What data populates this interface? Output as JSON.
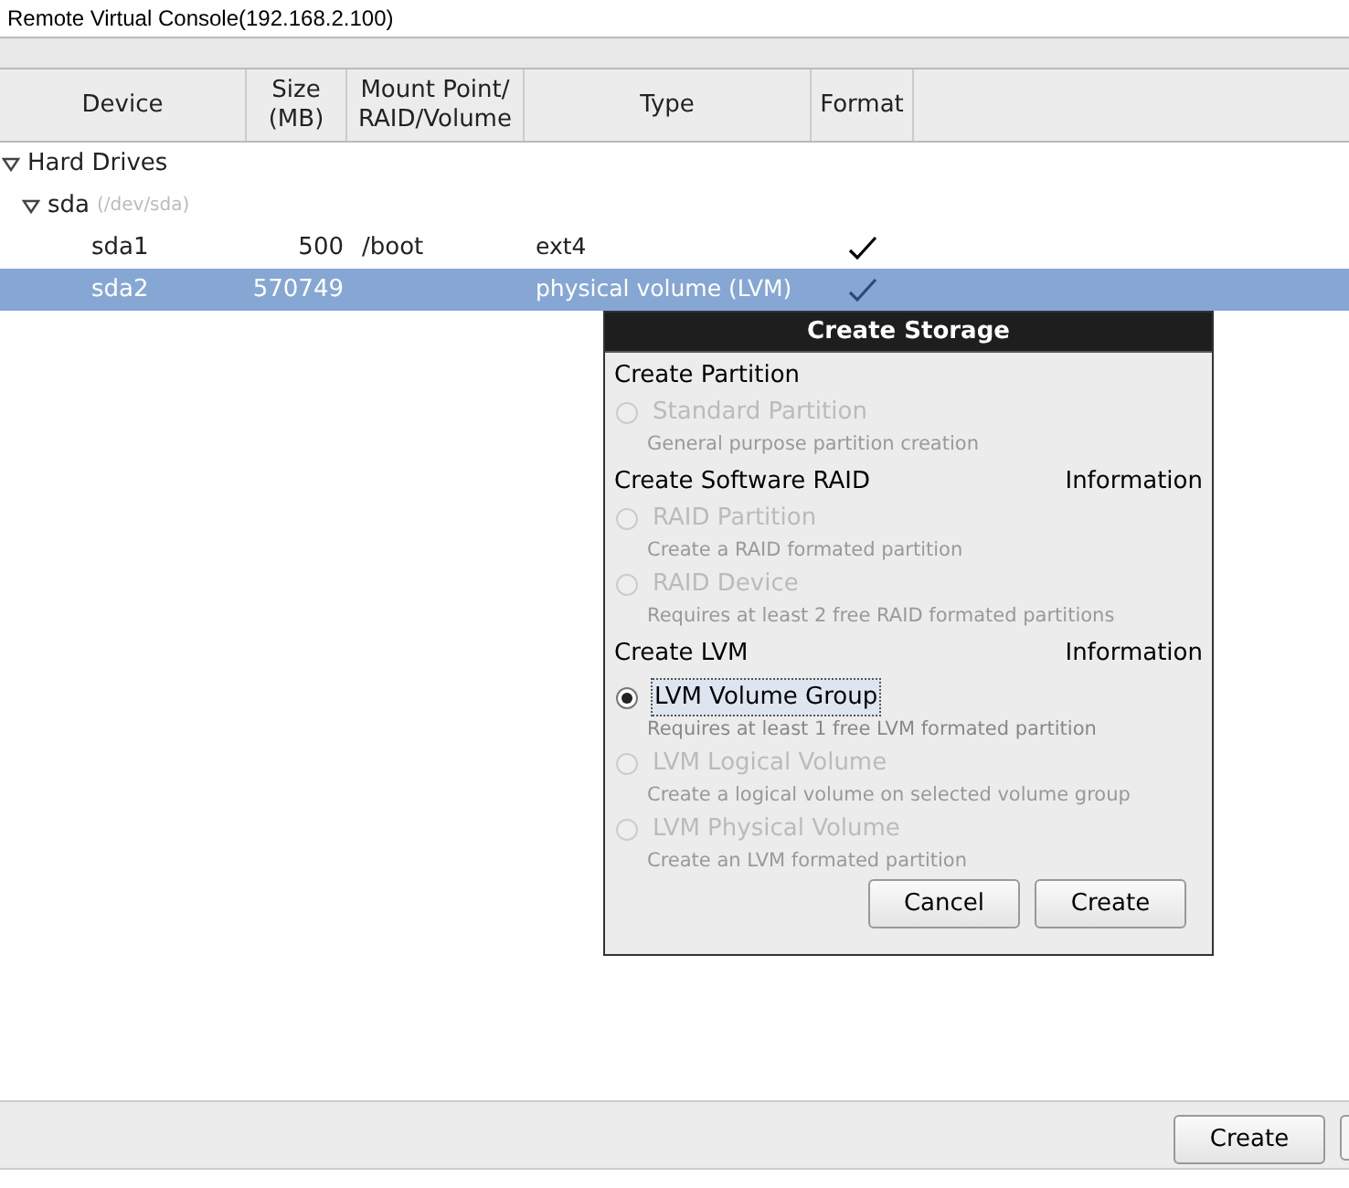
{
  "window": {
    "title": "Remote Virtual Console(192.168.2.100)"
  },
  "table": {
    "columns": [
      {
        "label": "Device"
      },
      {
        "label": "Size\n(MB)"
      },
      {
        "label": "Mount Point/\nRAID/Volume"
      },
      {
        "label": "Type"
      },
      {
        "label": "Format"
      }
    ],
    "tree": [
      {
        "device": "Hard Drives",
        "expanded": true,
        "children": [
          {
            "device": "sda",
            "path": "(/dev/sda)",
            "expanded": true,
            "children": [
              {
                "device": "sda1",
                "size": "500",
                "mount": "/boot",
                "type": "ext4",
                "format": true,
                "selected": false
              },
              {
                "device": "sda2",
                "size": "570749",
                "type": "physical volume (LVM)",
                "format": true,
                "selected": true
              }
            ]
          }
        ]
      }
    ]
  },
  "dialog": {
    "title": "Create Storage",
    "sections": [
      {
        "title": "Create Partition",
        "options": [
          {
            "label": "Standard Partition",
            "description": "General purpose partition creation",
            "selected": false,
            "disabled": true
          }
        ]
      },
      {
        "title": "Create Software RAID",
        "info": "Information",
        "options": [
          {
            "label": "RAID Partition",
            "description": "Create a RAID formated partition",
            "selected": false,
            "disabled": true
          },
          {
            "label": "RAID Device",
            "description": "Requires at least 2 free RAID formated partitions",
            "selected": false,
            "disabled": true
          }
        ]
      },
      {
        "title": "Create LVM",
        "info": "Information",
        "options": [
          {
            "label": "LVM Volume Group",
            "description": "Requires at least 1 free LVM formated partition",
            "selected": true,
            "disabled": false
          },
          {
            "label": "LVM Logical Volume",
            "description": "Create a logical volume on selected volume group",
            "selected": false,
            "disabled": true
          },
          {
            "label": "LVM Physical Volume",
            "description": "Create an LVM formated partition",
            "selected": false,
            "disabled": true
          }
        ]
      }
    ],
    "buttons": [
      "Cancel",
      "Create"
    ]
  },
  "bottom_buttons": [
    "Create"
  ]
}
